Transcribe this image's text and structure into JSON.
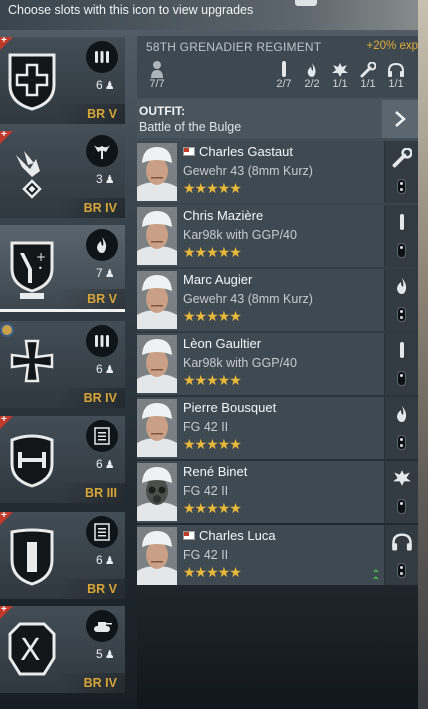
{
  "hint": "Choose slots with this icon to view upgrades",
  "regiment": {
    "name": "58TH GRENADIER REGIMENT",
    "exp": "+20% exp"
  },
  "stats": [
    {
      "icon": "person-icon",
      "value": "7/7"
    },
    {
      "icon": "bullet-icon",
      "value": "2/7"
    },
    {
      "icon": "flame-icon",
      "value": "2/2"
    },
    {
      "icon": "explosion-icon",
      "value": "1/1"
    },
    {
      "icon": "wrench-icon",
      "value": "1/1"
    },
    {
      "icon": "headphones-icon",
      "value": "1/1"
    }
  ],
  "outfit": {
    "label": "OUTFIT:",
    "value": "Battle of the Bulge"
  },
  "squads": [
    {
      "count": "6",
      "br": "BR V",
      "type": "rifle-ammo-icon",
      "emblem": "cross-shield",
      "plus": true
    },
    {
      "count": "3",
      "br": "BR IV",
      "type": "medic-icon",
      "emblem": "eagle",
      "plus": true
    },
    {
      "count": "7",
      "br": "BR V",
      "type": "flame-icon",
      "emblem": "division-shield",
      "plus": false
    },
    {
      "count": "6",
      "br": "BR IV",
      "type": "rifle-ammo-icon",
      "emblem": "iron-cross",
      "plus": false
    },
    {
      "count": "6",
      "br": "BR III",
      "type": "list-icon",
      "emblem": "h-shield",
      "plus": true
    },
    {
      "count": "6",
      "br": "BR V",
      "type": "list-icon",
      "emblem": "bar-shield",
      "plus": true
    },
    {
      "count": "5",
      "br": "BR IV",
      "type": "tank-icon",
      "emblem": "x-shield",
      "plus": true
    }
  ],
  "soldiers": [
    {
      "name": "Charles Gastaut",
      "weapon": "Gewehr 43 (8mm Kurz)",
      "stars": "★★★★★",
      "slot": "wrench-icon",
      "flag": true,
      "upgrade": false
    },
    {
      "name": "Chris Mazière",
      "weapon": "Kar98k with GGP/40",
      "stars": "★★★★★",
      "slot": "bullet-icon",
      "flag": false,
      "upgrade": false
    },
    {
      "name": "Marc Augier",
      "weapon": "Gewehr 43 (8mm Kurz)",
      "stars": "★★★★★",
      "slot": "flame-icon",
      "flag": false,
      "upgrade": false
    },
    {
      "name": "Lèon Gaultier",
      "weapon": "Kar98k with GGP/40",
      "stars": "★★★★★",
      "slot": "bullet-icon",
      "flag": false,
      "upgrade": false
    },
    {
      "name": "Pierre Bousquet",
      "weapon": "FG 42 II",
      "stars": "★★★★★",
      "slot": "flame-icon",
      "flag": false,
      "upgrade": false
    },
    {
      "name": "René Binet",
      "weapon": "FG 42 II",
      "stars": "★★★★★",
      "slot": "explosion-icon",
      "flag": false,
      "upgrade": false
    },
    {
      "name": "Charles Luca",
      "weapon": "FG 42 II",
      "stars": "★★★★★",
      "slot": "headphones-icon",
      "flag": true,
      "upgrade": true
    }
  ]
}
